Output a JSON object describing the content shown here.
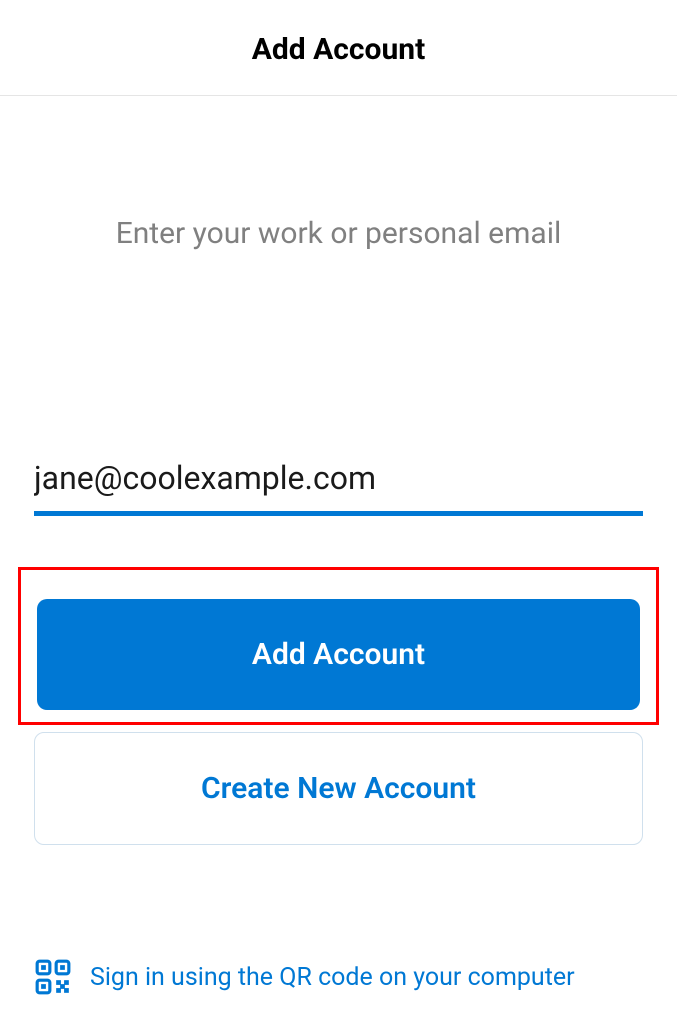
{
  "header": {
    "title": "Add Account"
  },
  "instruction": "Enter your work or personal email",
  "email": {
    "value": "jane@coolexample.com"
  },
  "buttons": {
    "add_account": "Add Account",
    "create_new": "Create New Account"
  },
  "qr_link": {
    "text": "Sign in using the QR code on your computer"
  }
}
